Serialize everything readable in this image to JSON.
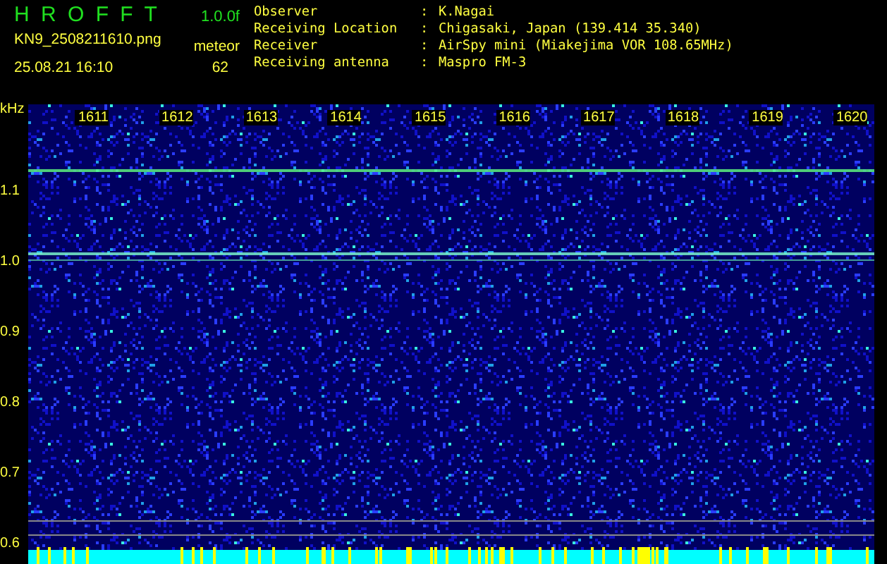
{
  "header": {
    "app_name": "H R O F F T",
    "version": "1.0.0f",
    "file_name": "KN9_2508211610.png",
    "mode": "meteor",
    "timestamp": "25.08.21 16:10",
    "count": "62",
    "info": [
      {
        "label": "Observer",
        "separator": ":",
        "value": "K.Nagai"
      },
      {
        "label": "Receiving Location",
        "separator": ":",
        "value": "Chigasaki, Japan (139.414 35.340)"
      },
      {
        "label": "Receiver",
        "separator": ":",
        "value": "AirSpy mini (Miakejima VOR 108.65MHz)"
      },
      {
        "label": "Receiving antenna",
        "separator": ":",
        "value": "Maspro FM-3"
      }
    ]
  },
  "spectrogram": {
    "y_unit": "kHz",
    "y_labels": [
      "1.1",
      "1.0",
      "0.9",
      "0.8",
      "0.7",
      "0.6"
    ],
    "x_labels": [
      "1611",
      "1612",
      "1613",
      "1614",
      "1615",
      "1616",
      "1617",
      "1618",
      "1619",
      "1620"
    ]
  }
}
